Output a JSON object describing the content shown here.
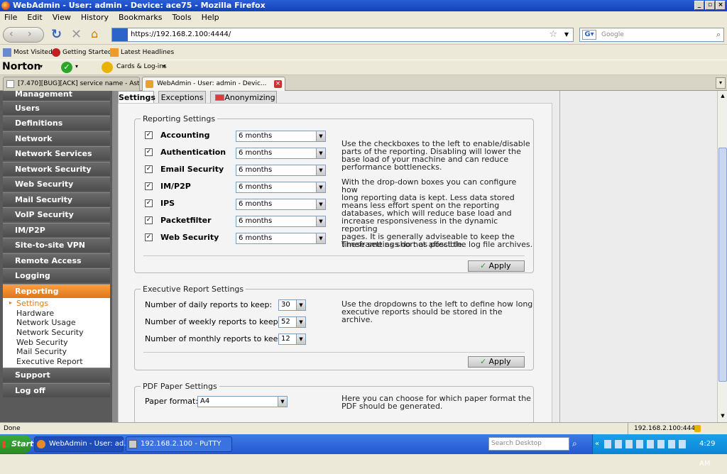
{
  "window": {
    "title": "WebAdmin - User: admin - Device: ace75 - Mozilla Firefox"
  },
  "menu": [
    "File",
    "Edit",
    "View",
    "History",
    "Bookmarks",
    "Tools",
    "Help"
  ],
  "nav": {
    "url": "https://192.168.2.100:4444/",
    "search_placeholder": "Google"
  },
  "bookmarks": [
    "Most Visited",
    "Getting Started",
    "Latest Headlines"
  ],
  "norton": {
    "brand": "Norton",
    "cards_label": "Cards & Log-ins"
  },
  "browser_tabs": [
    {
      "label": "[7.470][BUG][ACK] service name - Ast..."
    },
    {
      "label": "WebAdmin - User: admin - Devic..."
    }
  ],
  "sidebar": {
    "items": [
      {
        "label": "Management"
      },
      {
        "label": "Users"
      },
      {
        "label": "Definitions"
      },
      {
        "label": "Network"
      },
      {
        "label": "Network Services"
      },
      {
        "label": "Network Security"
      },
      {
        "label": "Web Security"
      },
      {
        "label": "Mail Security"
      },
      {
        "label": "VoIP Security"
      },
      {
        "label": "IM/P2P"
      },
      {
        "label": "Site-to-site VPN"
      },
      {
        "label": "Remote Access"
      },
      {
        "label": "Logging"
      },
      {
        "label": "Reporting"
      },
      {
        "label": "Support"
      },
      {
        "label": "Log off"
      }
    ],
    "submenu": [
      "Settings",
      "Hardware",
      "Network Usage",
      "Network Security",
      "Web Security",
      "Mail Security",
      "Executive Report"
    ]
  },
  "content_tabs": [
    "Settings",
    "Exceptions",
    "Anonymizing"
  ],
  "reporting": {
    "legend": "Reporting Settings",
    "rows": [
      {
        "label": "Accounting",
        "value": "6 months"
      },
      {
        "label": "Authentication",
        "value": "6 months"
      },
      {
        "label": "Email Security",
        "value": "6 months"
      },
      {
        "label": "IM/P2P",
        "value": "6 months"
      },
      {
        "label": "IPS",
        "value": "6 months"
      },
      {
        "label": "Packetfilter",
        "value": "6 months"
      },
      {
        "label": "Web Security",
        "value": "6 months"
      }
    ],
    "help": [
      [
        "Use the checkboxes to the left to enable/disable",
        "parts of the reporting. Disabling will lower the",
        "base load of your machine and can reduce",
        "performance bottlenecks."
      ],
      [
        "With the drop-down boxes you can configure how",
        "long reporting data is kept. Less data stored",
        "means less effort spent on the reporting",
        "databases, which will reduce base load and",
        "increase responsiveness in the dynamic reporting",
        "pages. It is generally adviseable to keep the",
        "timeframe as short as possible."
      ],
      [
        "These settings do not affect the log file archives."
      ]
    ],
    "apply": "Apply"
  },
  "executive": {
    "legend": "Executive Report Settings",
    "rows": [
      {
        "label": "Number of daily reports to keep:",
        "value": "30"
      },
      {
        "label": "Number of weekly reports to keep:",
        "value": "52"
      },
      {
        "label": "Number of monthly reports to keep:",
        "value": "12"
      }
    ],
    "help": [
      "Use the dropdowns to the left to define how long",
      "executive reports should be stored in the archive."
    ],
    "apply": "Apply"
  },
  "pdf": {
    "legend": "PDF Paper Settings",
    "label": "Paper format:",
    "value": "A4",
    "help": [
      "Here you can choose for which paper format the",
      "PDF should be generated."
    ]
  },
  "status": {
    "text": "Done",
    "host": "192.168.2.100:4444"
  },
  "taskbar": {
    "start": "Start",
    "tasks": [
      "WebAdmin - User: ad...",
      "192.168.2.100 - PuTTY"
    ],
    "search_placeholder": "Search Desktop",
    "clock": "4:29 AM"
  }
}
